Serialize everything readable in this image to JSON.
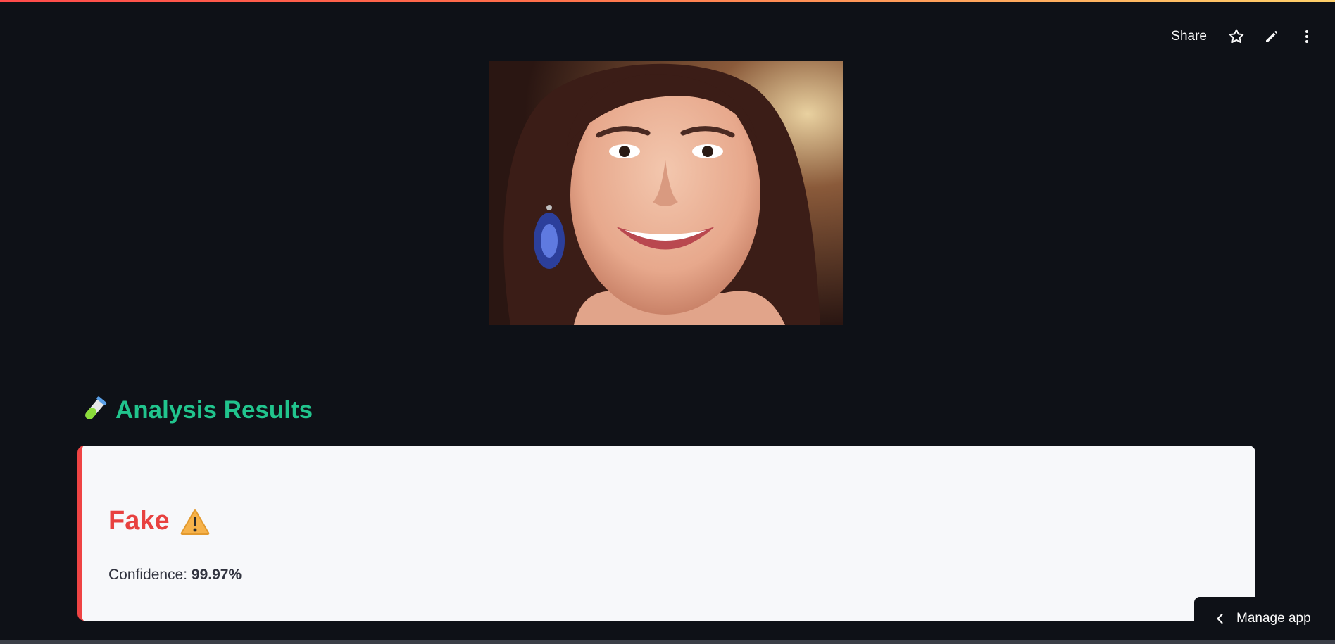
{
  "toolbar": {
    "share_label": "Share",
    "icons": [
      "star-icon",
      "pencil-icon",
      "more-vert-icon"
    ]
  },
  "image": {
    "description_icon": "uploaded-face-photo"
  },
  "results": {
    "heading_icon": "test-tube-icon",
    "heading": "Analysis Results",
    "verdict": "Fake",
    "verdict_icon": "warning-icon",
    "confidence_label": "Confidence:",
    "confidence_value": "99.97%"
  },
  "manage_app": {
    "label": "Manage app",
    "icon": "chevron-left-icon"
  },
  "colors": {
    "background": "#0e1117",
    "heading_green": "#21c48d",
    "fake_red": "#e8413f",
    "card_bg": "#f7f8fa"
  }
}
